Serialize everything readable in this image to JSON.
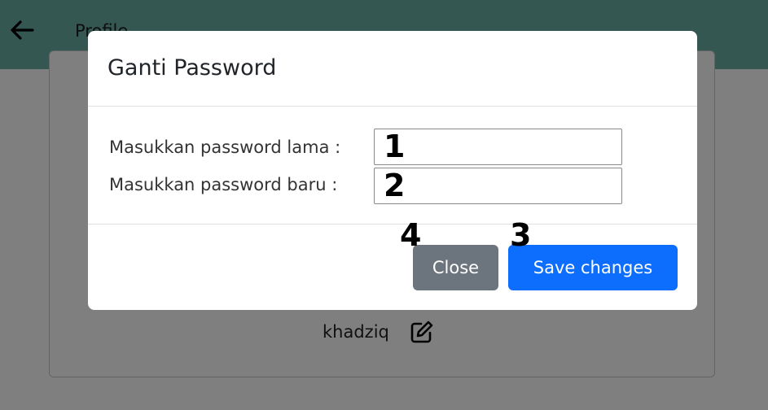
{
  "header": {
    "title": "Profile",
    "background_color": "#6aafa5",
    "back_icon": "arrow-left-icon"
  },
  "profile": {
    "username": "khadziq",
    "edit_icon": "edit-icon"
  },
  "modal": {
    "title": "Ganti Password",
    "fields": [
      {
        "label": "Masukkan password lama :",
        "value": ""
      },
      {
        "label": "Masukkan password baru :",
        "value": ""
      }
    ],
    "buttons": {
      "close_label": "Close",
      "save_label": "Save changes",
      "close_color": "#6c757d",
      "save_color": "#0d6efd"
    }
  },
  "annotations": {
    "old_password": "1",
    "new_password": "2",
    "save": "3",
    "close": "4"
  }
}
